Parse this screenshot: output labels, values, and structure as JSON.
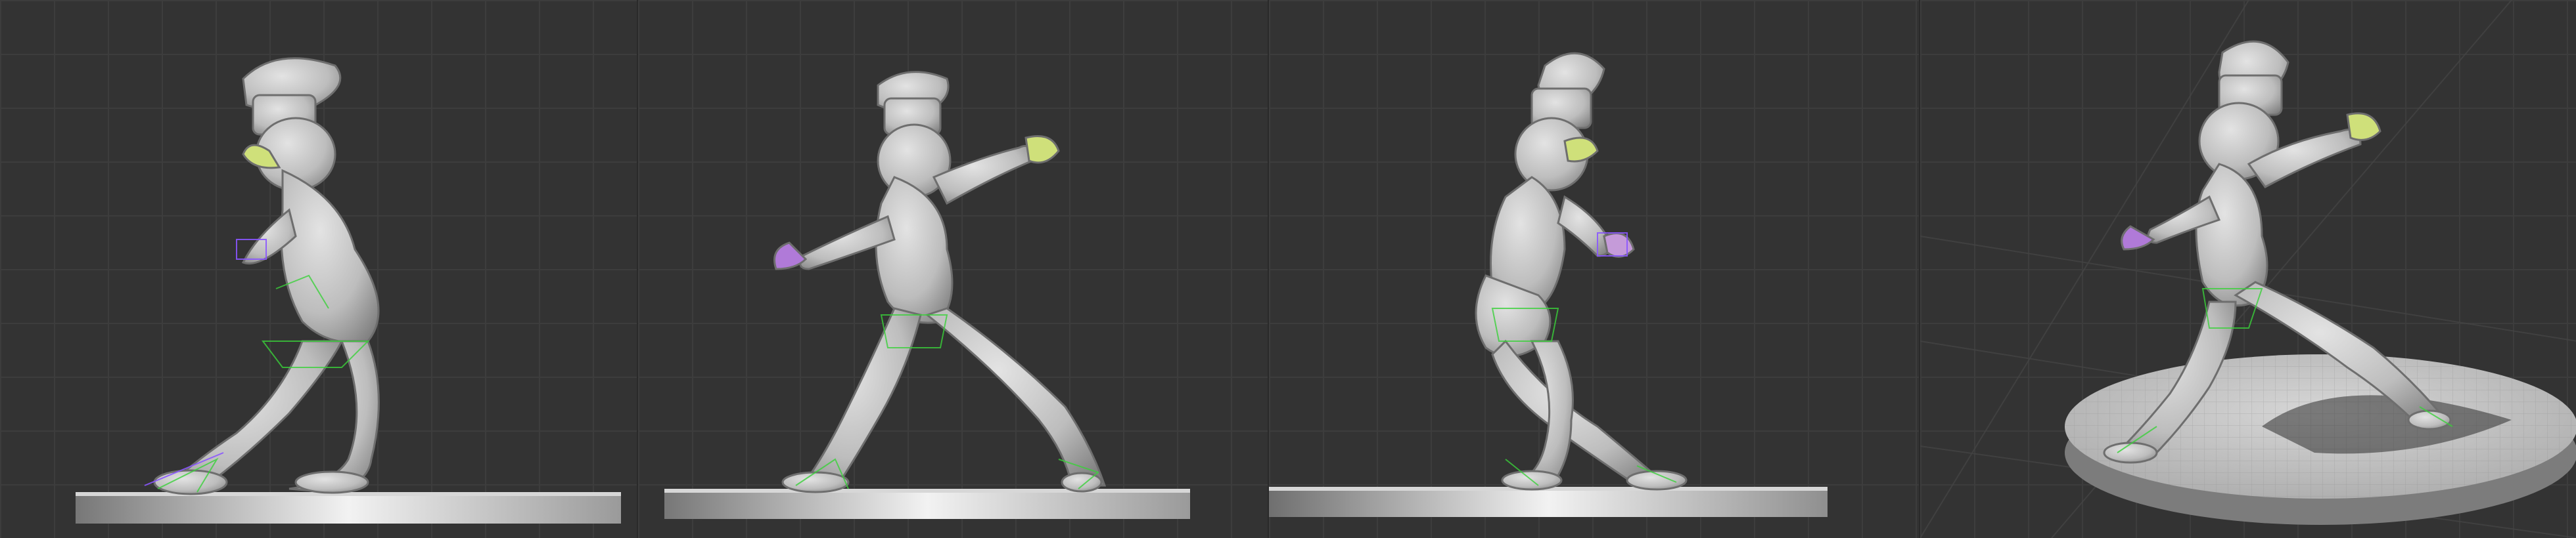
{
  "scene": {
    "subject": "figure-model",
    "views": [
      {
        "id": "front-left"
      },
      {
        "id": "front"
      },
      {
        "id": "side"
      },
      {
        "id": "perspective"
      }
    ],
    "colors": {
      "viewport_bg": "#333333",
      "grid_line": "#3d3d3d",
      "model": "#b9b9b9",
      "model_shadow": "#7f7f7f",
      "rig_lines": "#3ad13a",
      "rig_helpers": "#8a55ff",
      "accent_hand": "#cfe07a"
    }
  }
}
